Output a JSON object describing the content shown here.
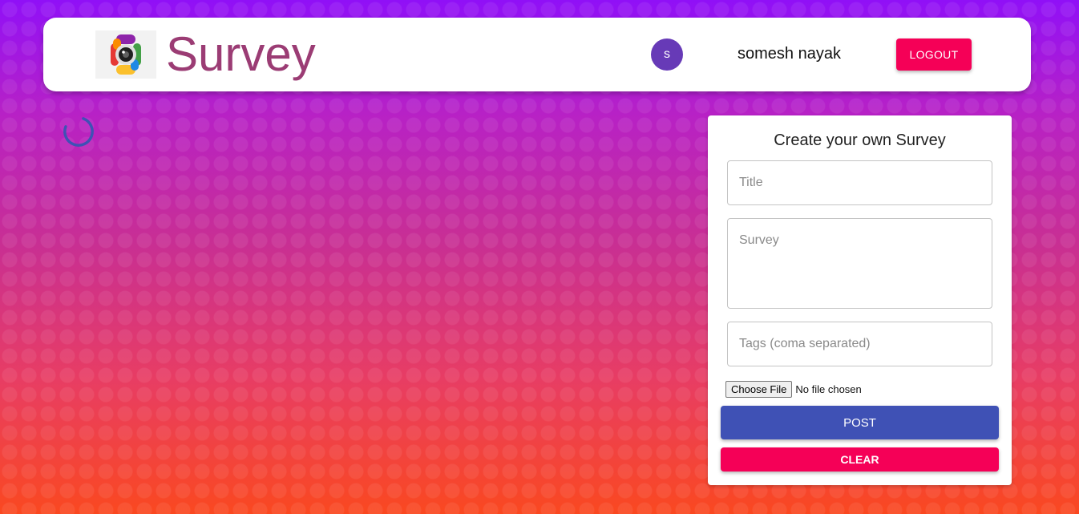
{
  "header": {
    "logo_icon": "camera-lens-logo-icon",
    "title": "Survey",
    "avatar_initial": "s",
    "username": "somesh nayak",
    "logout_label": "LOGOUT"
  },
  "loading": {
    "icon": "loading-spinner-icon"
  },
  "form": {
    "heading": "Create your own Survey",
    "title_placeholder": "Title",
    "survey_placeholder": "Survey",
    "tags_placeholder": "Tags (coma separated)",
    "choose_file_label": "Choose File",
    "file_status": "No file chosen",
    "post_label": "POST",
    "clear_label": "CLEAR"
  },
  "colors": {
    "brand_title": "#9b3c74",
    "avatar_bg": "#673ab7",
    "secondary": "#f50057",
    "primary": "#3f51b5",
    "spinner": "#3f51b5"
  }
}
